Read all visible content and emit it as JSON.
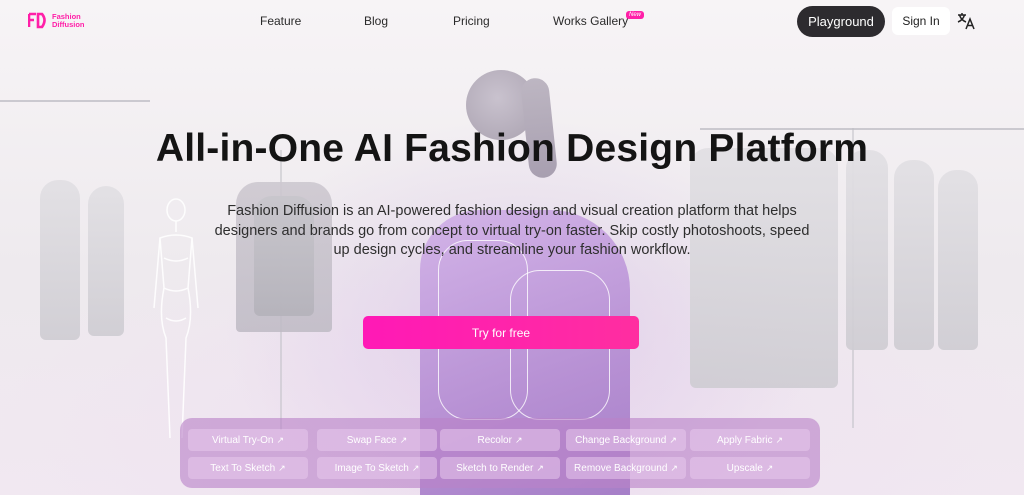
{
  "brand": {
    "name_line1": "Fashion",
    "name_line2": "Diffusion",
    "accent": "#ff1fa8"
  },
  "nav": {
    "items": [
      "Feature",
      "Blog",
      "Pricing",
      "Works Gallery"
    ],
    "new_badge": "New",
    "playground": "Playground",
    "sign_in": "Sign In",
    "language_icon": "translate-icon"
  },
  "hero": {
    "title": "All-in-One AI Fashion Design Platform",
    "description": "Fashion Diffusion is an AI-powered fashion design and visual creation platform that helps designers and brands go from concept to virtual try-on faster. Skip costly photoshoots, speed up design cycles, and streamline your fashion workflow.",
    "cta": "Try for free"
  },
  "tools": {
    "row1": [
      "Virtual Try-On",
      "Swap Face",
      "Recolor",
      "Change Background",
      "Apply Fabric"
    ],
    "row2": [
      "Text To Sketch",
      "Image To Sketch",
      "Sketch to Render",
      "Remove Background",
      "Upscale"
    ],
    "arrow": "↗"
  }
}
